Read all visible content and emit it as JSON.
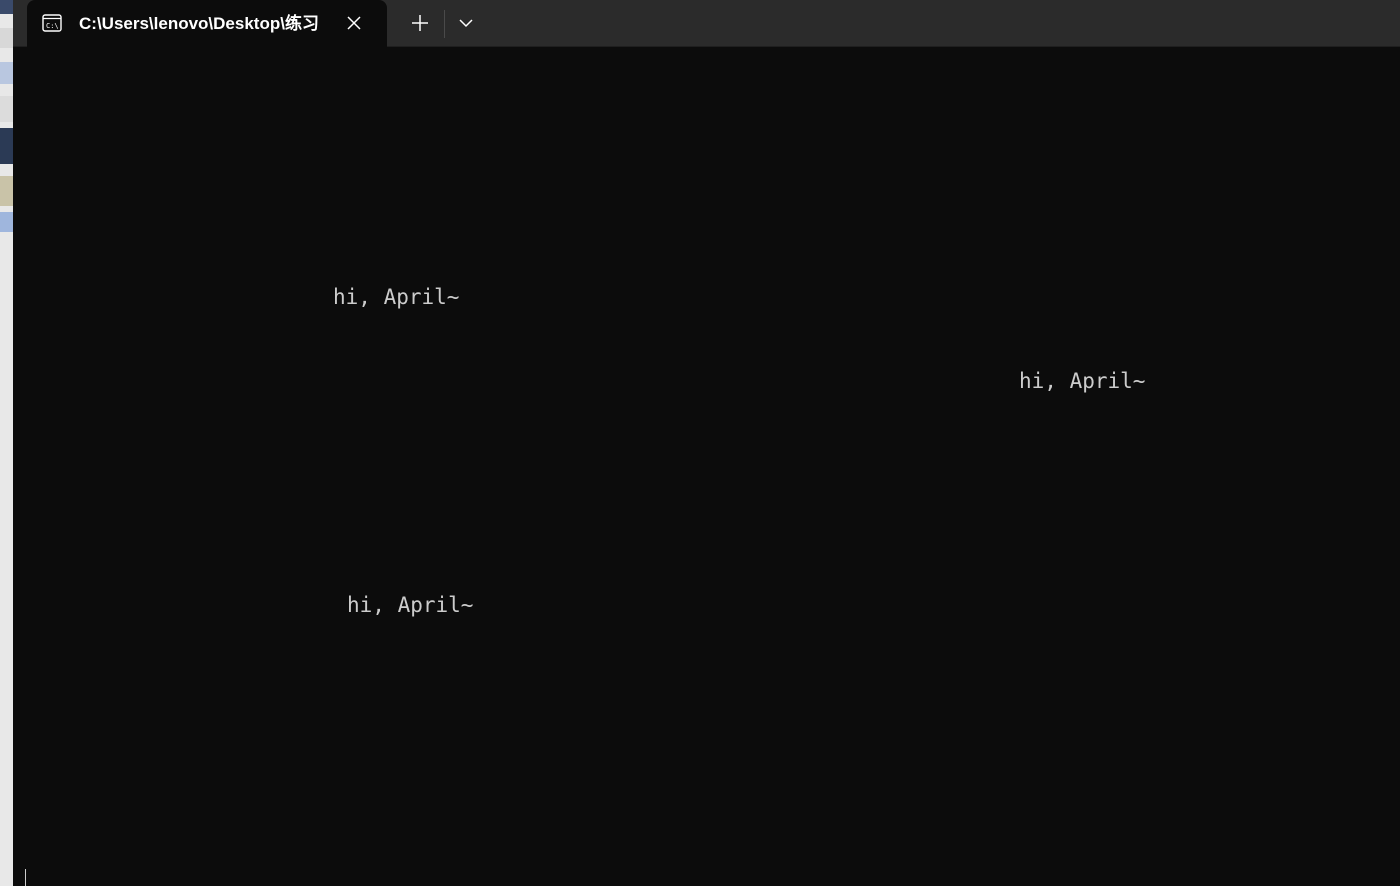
{
  "window": {
    "tab_title": "C:\\Users\\lenovo\\Desktop\\练习",
    "tab_icon": "command-prompt-icon",
    "close_icon": "close-icon",
    "new_tab_icon": "plus-icon",
    "dropdown_icon": "chevron-down-icon"
  },
  "terminal": {
    "lines": [
      {
        "text": "hi, April~"
      },
      {
        "text": "hi, April~"
      },
      {
        "text": "hi, April~"
      }
    ]
  },
  "colors": {
    "background": "#0c0c0c",
    "titlebar": "#2b2b2b",
    "text": "#cccccc"
  }
}
